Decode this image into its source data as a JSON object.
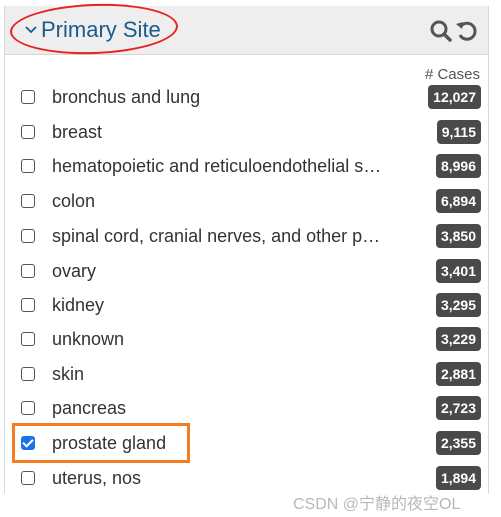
{
  "facet": {
    "title": "Primary Site",
    "cases_header": "# Cases",
    "icons": [
      "chevron-down-icon",
      "search-icon",
      "reset-icon"
    ]
  },
  "items": [
    {
      "label": "bronchus and lung",
      "count": "12,027",
      "checked": false
    },
    {
      "label": "breast",
      "count": "9,115",
      "checked": false
    },
    {
      "label": "hematopoietic and reticuloendothelial s…",
      "count": "8,996",
      "checked": false
    },
    {
      "label": "colon",
      "count": "6,894",
      "checked": false
    },
    {
      "label": "spinal cord, cranial nerves, and other p…",
      "count": "3,850",
      "checked": false
    },
    {
      "label": "ovary",
      "count": "3,401",
      "checked": false
    },
    {
      "label": "kidney",
      "count": "3,295",
      "checked": false
    },
    {
      "label": "unknown",
      "count": "3,229",
      "checked": false
    },
    {
      "label": "skin",
      "count": "2,881",
      "checked": false
    },
    {
      "label": "pancreas",
      "count": "2,723",
      "checked": false
    },
    {
      "label": "prostate gland",
      "count": "2,355",
      "checked": true
    },
    {
      "label": "uterus, nos",
      "count": "1,894",
      "checked": false
    }
  ],
  "watermark": "CSDN @宁静的夜空OL",
  "colors": {
    "title": "#1a5b8c",
    "badge": "#4a4a4a",
    "circle": "#e8211d",
    "highlight": "#f57c1f",
    "check": "#1a73e8"
  }
}
